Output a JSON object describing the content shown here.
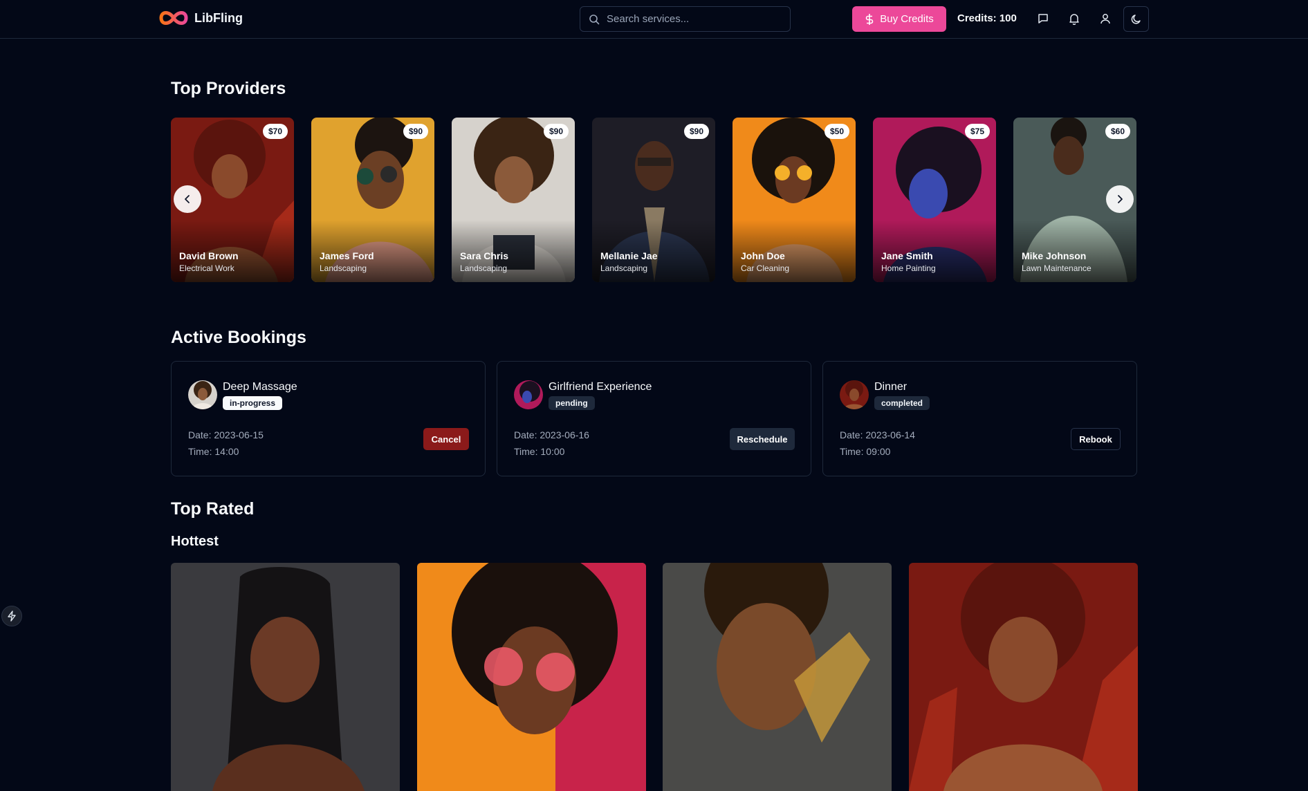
{
  "app": {
    "name": "LibFling"
  },
  "header": {
    "search_placeholder": "Search services...",
    "buy_credits_label": "Buy Credits",
    "credits_text": "Credits: 100"
  },
  "sections": {
    "top_providers": "Top Providers",
    "active_bookings": "Active Bookings",
    "top_rated": "Top Rated",
    "hottest": "Hottest"
  },
  "providers": [
    {
      "name": "David Brown",
      "service": "Electrical Work",
      "price": "$70"
    },
    {
      "name": "James Ford",
      "service": "Landscaping",
      "price": "$90"
    },
    {
      "name": "Sara Chris",
      "service": "Landscaping",
      "price": "$90"
    },
    {
      "name": "Mellanie Jae",
      "service": "Landscaping",
      "price": "$90"
    },
    {
      "name": "John Doe",
      "service": "Car Cleaning",
      "price": "$50"
    },
    {
      "name": "Jane Smith",
      "service": "Home Painting",
      "price": "$75"
    },
    {
      "name": "Mike Johnson",
      "service": "Lawn Maintenance",
      "price": "$60"
    }
  ],
  "bookings": [
    {
      "title": "Deep Massage",
      "status": "in-progress",
      "date": "Date: 2023-06-15",
      "time": "Time: 14:00",
      "action": "Cancel"
    },
    {
      "title": "Girlfriend Experience",
      "status": "pending",
      "date": "Date: 2023-06-16",
      "time": "Time: 10:00",
      "action": "Reschedule"
    },
    {
      "title": "Dinner",
      "status": "completed",
      "date": "Date: 2023-06-14",
      "time": "Time: 09:00",
      "action": "Rebook"
    }
  ],
  "colors": {
    "background": "#030817",
    "accent": "#ec4899",
    "cancel": "#8b1a1a"
  }
}
